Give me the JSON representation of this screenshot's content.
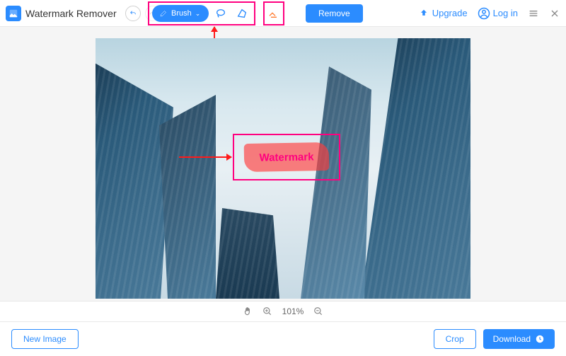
{
  "header": {
    "title": "Watermark Remover",
    "upgrade": "Upgrade",
    "login": "Log in"
  },
  "tools": {
    "brush_label": "Brush",
    "remove_label": "Remove"
  },
  "canvas": {
    "watermark_text": "Watermark"
  },
  "zoom": {
    "level": "101%"
  },
  "footer": {
    "new_image": "New Image",
    "crop": "Crop",
    "download": "Download"
  }
}
